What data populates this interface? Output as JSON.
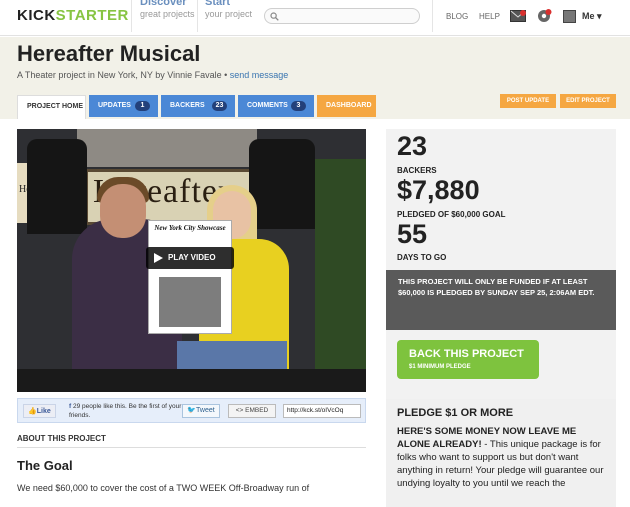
{
  "nav": {
    "logo_left": "KICK",
    "logo_right": "STARTER",
    "discover": {
      "title": "Discover",
      "sub": "great projects"
    },
    "start": {
      "title": "Start",
      "sub": "your project"
    },
    "search_placeholder": "",
    "blog": "BLOG",
    "help": "HELP",
    "me": "Me"
  },
  "project": {
    "title": "Hereafter Musical",
    "subtitle_text": "A Theater project in New York, NY by Vinnie Favale • ",
    "send_message": "send message"
  },
  "tabs": [
    {
      "label": "PROJECT HOME"
    },
    {
      "label": "UPDATES",
      "count": "1"
    },
    {
      "label": "BACKERS",
      "count": "23"
    },
    {
      "label": "COMMENTS",
      "count": "3"
    },
    {
      "label": "DASHBOARD"
    }
  ],
  "actions": {
    "post_update": "POST UPDATE",
    "edit_project": "EDIT PROJECT"
  },
  "video": {
    "play_label": "PLAY VIDEO",
    "banner_text": "Hereafter",
    "poster_title": "New York City Showcase",
    "side_sign": "Hereafter"
  },
  "share": {
    "like": "Like",
    "like_count_text": "29 people like this. Be the first of your friends.",
    "tweet": "Tweet",
    "embed": "<> EMBED",
    "short_url": "http://kck.st/oIVcOq"
  },
  "about": {
    "heading": "ABOUT THIS PROJECT",
    "goal_title": "The Goal",
    "text": "We need $60,000 to cover the cost of a TWO WEEK Off-Broadway run of"
  },
  "stats": {
    "backers": "23",
    "backers_label": "BACKERS",
    "pledged": "$7,880",
    "pledged_label": "PLEDGED OF $60,000 GOAL",
    "days": "55",
    "days_label": "DAYS TO GO",
    "notice": "THIS PROJECT WILL ONLY BE FUNDED IF AT LEAST $60,000 IS PLEDGED BY SUNDAY SEP 25, 2:06AM EDT."
  },
  "back": {
    "label": "BACK THIS PROJECT",
    "sub": "$1 MINIMUM PLEDGE"
  },
  "pledge": {
    "title": "PLEDGE $1 OR MORE",
    "text_strong": "HERE'S SOME MONEY NOW LEAVE ME ALONE ALREADY!",
    "text_rest": " - This unique package is for folks who want to support us but don't want anything in return! Your pledge will guarantee our undying loyalty to you until we reach the"
  },
  "colors": {
    "accent_green": "#87c442",
    "tab_blue": "#4b88d6",
    "tab_orange": "#f5a742",
    "back_button": "#7ec33e"
  }
}
